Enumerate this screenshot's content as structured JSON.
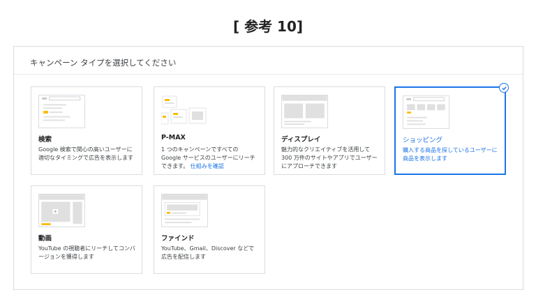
{
  "page_title": "[ 参考 10]",
  "panel": {
    "header": "キャンペーン タイプを選択してください"
  },
  "cards": [
    {
      "id": "search",
      "title": "検索",
      "desc": "Google 検索で関心の高いユーザーに適切なタイミングで広告を表示します",
      "selected": false
    },
    {
      "id": "pmax",
      "title": "P-MAX",
      "desc": "1 つのキャンペーンですべての Google サービスのユーザーにリーチできます。",
      "link": "仕組みを確認",
      "selected": false
    },
    {
      "id": "display",
      "title": "ディスプレイ",
      "desc": "魅力的なクリエイティブを活用して 300 万件のサイトやアプリでユーザーにアプローチできます",
      "selected": false
    },
    {
      "id": "shopping",
      "title": "ショッピング",
      "desc": "購入する商品を探しているユーザーに商品を表示します",
      "selected": true
    },
    {
      "id": "video",
      "title": "動画",
      "desc": "YouTube の視聴者にリーチしてコンバージョンを獲得します",
      "selected": false
    },
    {
      "id": "discover",
      "title": "ファインド",
      "desc": "YouTube、Gmail、Discover などで広告を配信します",
      "selected": false
    }
  ],
  "colors": {
    "accent": "#1a73e8",
    "highlight": "#fbbc04",
    "border": "#dadce0"
  }
}
